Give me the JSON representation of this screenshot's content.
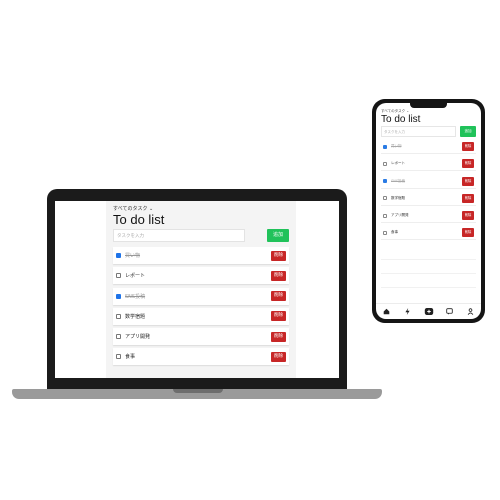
{
  "app": {
    "filter_label": "すべてのタスク ⌄",
    "title": "To do list",
    "input_placeholder": "タスクを入力",
    "add_button": "追加",
    "delete_label": "削除",
    "tasks": [
      {
        "label": "買い物",
        "done": true
      },
      {
        "label": "レポート",
        "done": false
      },
      {
        "label": "SNS投稿",
        "done": true
      },
      {
        "label": "数学宿題",
        "done": false
      },
      {
        "label": "アプリ開発",
        "done": false
      },
      {
        "label": "食事",
        "done": false
      }
    ]
  },
  "phone_nav": {
    "items": [
      "home-icon",
      "bolt-icon",
      "add-icon",
      "chat-icon",
      "profile-icon"
    ]
  },
  "colors": {
    "accent_green": "#20c25a",
    "delete_red": "#c72626",
    "check_blue": "#1e73e8"
  }
}
